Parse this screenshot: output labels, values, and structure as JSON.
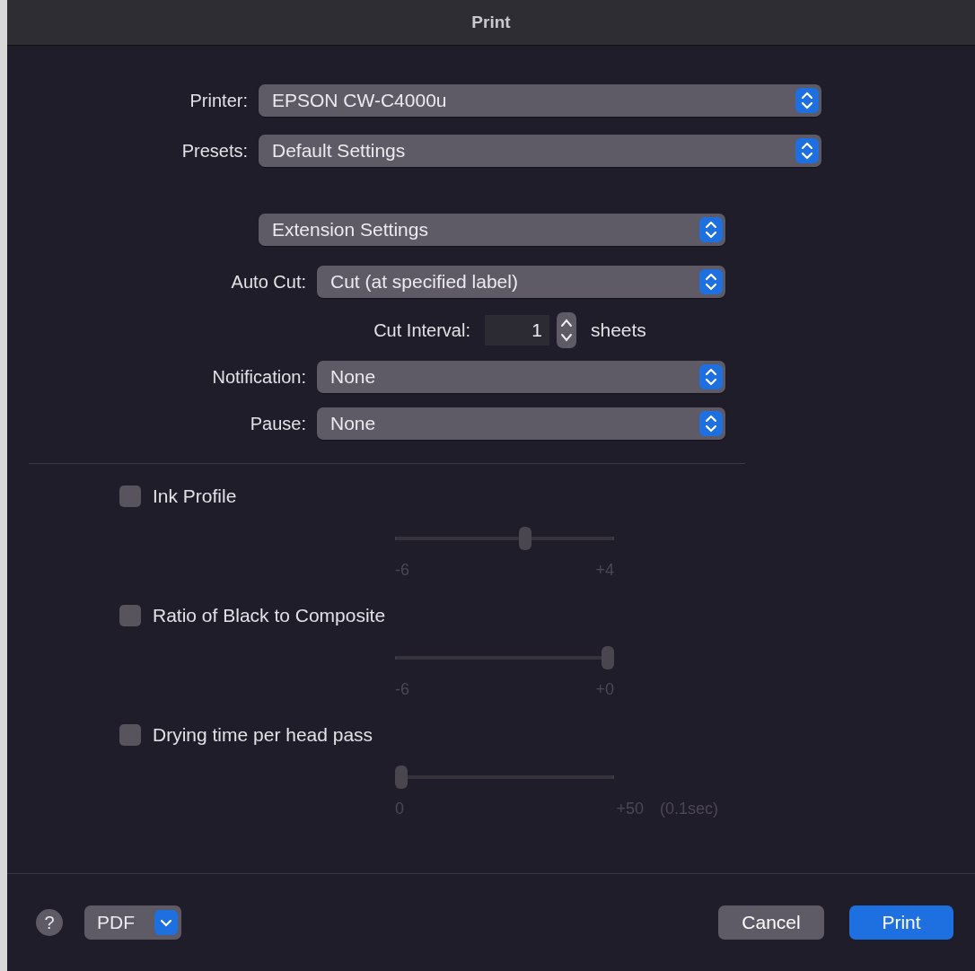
{
  "window": {
    "title": "Print"
  },
  "printer": {
    "label": "Printer:",
    "value": "EPSON CW-C4000u"
  },
  "presets": {
    "label": "Presets:",
    "value": "Default Settings"
  },
  "section": {
    "value": "Extension Settings"
  },
  "auto_cut": {
    "label": "Auto Cut:",
    "value": "Cut (at specified label)"
  },
  "cut_interval": {
    "label": "Cut Interval:",
    "value": "1",
    "unit": "sheets"
  },
  "notification": {
    "label": "Notification:",
    "value": "None"
  },
  "pause": {
    "label": "Pause:",
    "value": "None"
  },
  "options": [
    {
      "label": "Ink Profile",
      "checked": false,
      "level": 0.6,
      "min": "-6",
      "max": "+4"
    },
    {
      "label": "Ratio of Black to Composite",
      "checked": false,
      "level": 1,
      "min": "-6",
      "max": "+0"
    },
    {
      "label": "Drying time per head pass",
      "checked": false,
      "level": 0,
      "min": "0",
      "max": "+50",
      "unit": "(0.1sec)"
    }
  ],
  "footer": {
    "help": "?",
    "pdf": "PDF",
    "cancel": "Cancel",
    "print": "Print"
  }
}
